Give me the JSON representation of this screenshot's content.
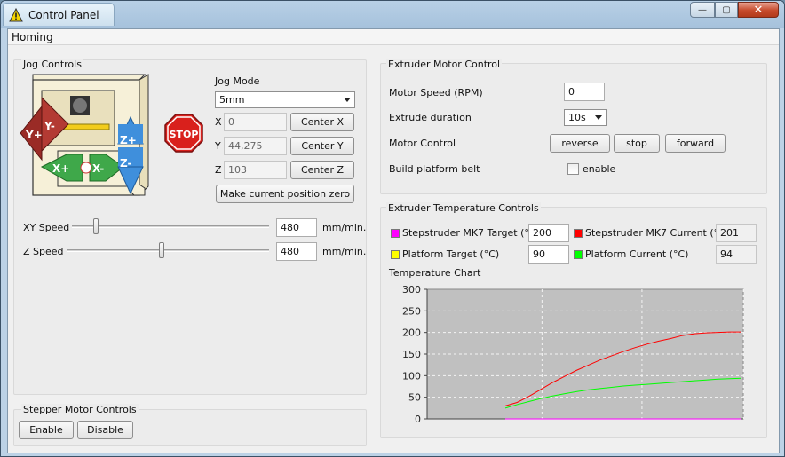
{
  "window": {
    "title": "Control Panel",
    "minimize_glyph": "—",
    "maximize_glyph": "▢",
    "close_glyph": "✕"
  },
  "menu": {
    "items": [
      "Homing"
    ]
  },
  "jog": {
    "title": "Jog Controls",
    "mode_label": "Jog Mode",
    "mode_value": "5mm",
    "axes": [
      {
        "name": "X",
        "value": "0",
        "button": "Center X"
      },
      {
        "name": "Y",
        "value": "44,275",
        "button": "Center Y"
      },
      {
        "name": "Z",
        "value": "103",
        "button": "Center Z"
      }
    ],
    "zero_button": "Make current position zero",
    "stop_label": "STOP",
    "arrow_labels": {
      "y_plus": "Y+",
      "y_minus": "Y-",
      "x_plus": "X+",
      "x_minus": "X-",
      "z_plus": "Z+",
      "z_minus": "Z-"
    },
    "xy_speed": {
      "label": "XY Speed",
      "value": "480",
      "unit": "mm/min.",
      "level": 0.12
    },
    "z_speed": {
      "label": "Z Speed",
      "value": "480",
      "unit": "mm/min.",
      "level": 0.47
    }
  },
  "stepper": {
    "title": "Stepper Motor Controls",
    "enable": "Enable",
    "disable": "Disable"
  },
  "extruder": {
    "title": "Extruder Motor Control",
    "motor_speed_label": "Motor Speed (RPM)",
    "motor_speed_value": "0",
    "duration_label": "Extrude duration",
    "duration_value": "10s",
    "control_label": "Motor Control",
    "reverse": "reverse",
    "stop": "stop",
    "forward": "forward",
    "belt_label": "Build platform belt",
    "belt_checkbox": "enable"
  },
  "temps": {
    "title": "Extruder Temperature Controls",
    "target_label": "Stepstruder MK7 Target (°C)",
    "target_value": "200",
    "current_label": "Stepstruder MK7 Current (°C)",
    "current_value": "201",
    "platform_target_label": "Platform Target (°C)",
    "platform_target_value": "90",
    "platform_current_label": "Platform Current (°C)",
    "platform_current_value": "94",
    "chart_title": "Temperature Chart",
    "colors": {
      "target": "#ff00ff",
      "current": "#ff0000",
      "platform_target": "#ffff00",
      "platform_current": "#00ff00"
    }
  },
  "chart_data": {
    "type": "line",
    "title": "Temperature Chart",
    "xlabel": "",
    "ylabel": "",
    "ylim": [
      0,
      300
    ],
    "yticks": [
      "0",
      "50",
      "100",
      "150",
      "200",
      "250",
      "300"
    ],
    "grid": true,
    "x": [
      0.0,
      0.05,
      0.1,
      0.15,
      0.2,
      0.25,
      0.3,
      0.35,
      0.4,
      0.45,
      0.5,
      0.55,
      0.6,
      0.65,
      0.7,
      0.75,
      0.8,
      0.85,
      0.9,
      0.95,
      1.0
    ],
    "series": [
      {
        "color": "#ff0000",
        "values": [
          30,
          38,
          52,
          68,
          84,
          98,
          112,
          124,
          136,
          146,
          156,
          165,
          173,
          180,
          186,
          193,
          197,
          199,
          200,
          201,
          201
        ]
      },
      {
        "color": "#00ff00",
        "values": [
          25,
          33,
          40,
          47,
          53,
          58,
          63,
          67,
          70,
          73,
          76,
          78,
          80,
          82,
          84,
          86,
          88,
          90,
          92,
          93,
          94
        ]
      },
      {
        "color": "#ff00ff",
        "values": [
          0,
          0,
          0,
          0,
          0,
          0,
          0,
          0,
          0,
          0,
          0,
          0,
          0,
          0,
          0,
          0,
          0,
          0,
          0,
          0,
          0
        ]
      }
    ]
  }
}
